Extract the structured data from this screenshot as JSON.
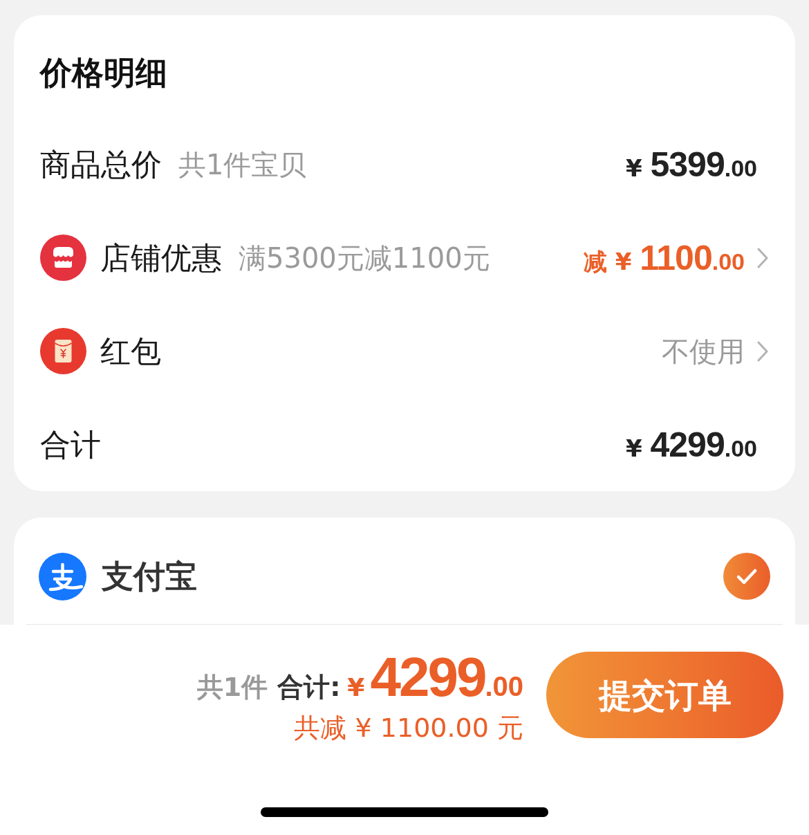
{
  "price_details": {
    "title": "价格明细",
    "rows": [
      {
        "kind": "subtotal",
        "label": "商品总价",
        "note": "共1件宝贝",
        "amount": "¥ 5399.00"
      },
      {
        "kind": "discount",
        "label": "店铺优惠",
        "note": "满5300元减1100元",
        "amount": "减 ¥ 1100.00"
      },
      {
        "kind": "coupon",
        "label": "红包",
        "value": "不使用"
      },
      {
        "kind": "total",
        "label": "合计",
        "amount": "¥ 4299.00"
      }
    ]
  },
  "payment_methods": [
    {
      "name": "支付宝",
      "selected": true
    }
  ],
  "footer": {
    "count": "共1件",
    "total_label": "合计:",
    "total": "¥4299.00",
    "saving": "共减 ¥ 1100.00 元",
    "submit_button": "提交订单"
  }
}
